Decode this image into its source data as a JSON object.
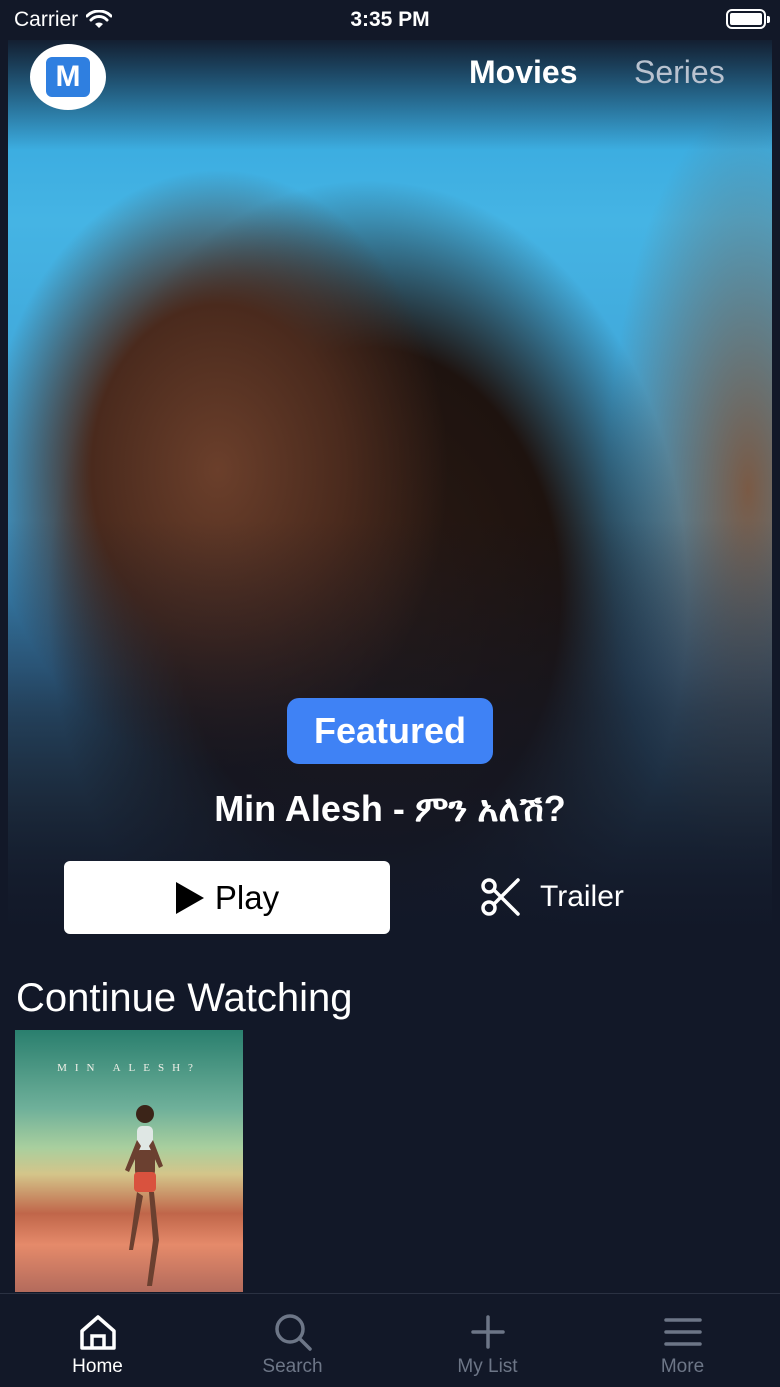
{
  "status_bar": {
    "carrier": "Carrier",
    "time": "3:35 PM"
  },
  "header": {
    "tabs": [
      {
        "label": "Movies",
        "active": true
      },
      {
        "label": "Series",
        "active": false
      }
    ]
  },
  "featured": {
    "badge": "Featured",
    "title": "Min Alesh - ምን አለሽ?",
    "play_label": "Play",
    "trailer_label": "Trailer"
  },
  "continue_watching": {
    "title": "Continue Watching",
    "items": [
      {
        "poster_title": "MIN ALESH?"
      }
    ]
  },
  "tab_bar": {
    "items": [
      {
        "label": "Home",
        "icon": "home-icon",
        "active": true
      },
      {
        "label": "Search",
        "icon": "search-icon",
        "active": false
      },
      {
        "label": "My List",
        "icon": "plus-icon",
        "active": false
      },
      {
        "label": "More",
        "icon": "menu-icon",
        "active": false
      }
    ]
  },
  "colors": {
    "background": "#121828",
    "accent": "#3f82f5",
    "inactive": "#6d7687"
  }
}
